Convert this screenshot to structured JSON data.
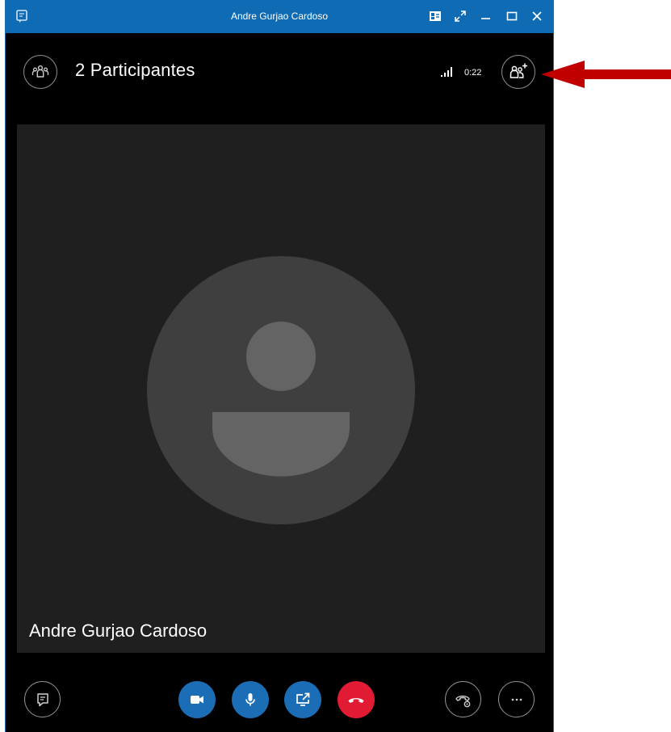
{
  "window": {
    "title": "Andre Gurjao Cardoso",
    "titlebar_color": "#0f6cb4",
    "titlebar_buttons": [
      "contact-card-icon",
      "popout-icon",
      "minimize-icon",
      "maximize-icon",
      "close-icon"
    ]
  },
  "header": {
    "participants_label": "2 Participantes",
    "call_timer": "0:22",
    "signal_icon": "signal-bars-icon",
    "add_people_icon": "add-people-icon"
  },
  "stage": {
    "caller_name": "Andre Gurjao Cardoso",
    "avatar_icon": "default-avatar-icon"
  },
  "controls": {
    "chat_icon": "chat-icon",
    "video_icon": "video-camera-icon",
    "mic_icon": "microphone-icon",
    "share_icon": "share-screen-icon",
    "hangup_icon": "hang-up-icon",
    "call_controls_icon": "call-controls-icon",
    "more_icon": "more-options-icon",
    "accent_color": "#1b6db5",
    "hangup_color": "#e21b35"
  },
  "annotation": {
    "arrow_color": "#c00000"
  }
}
